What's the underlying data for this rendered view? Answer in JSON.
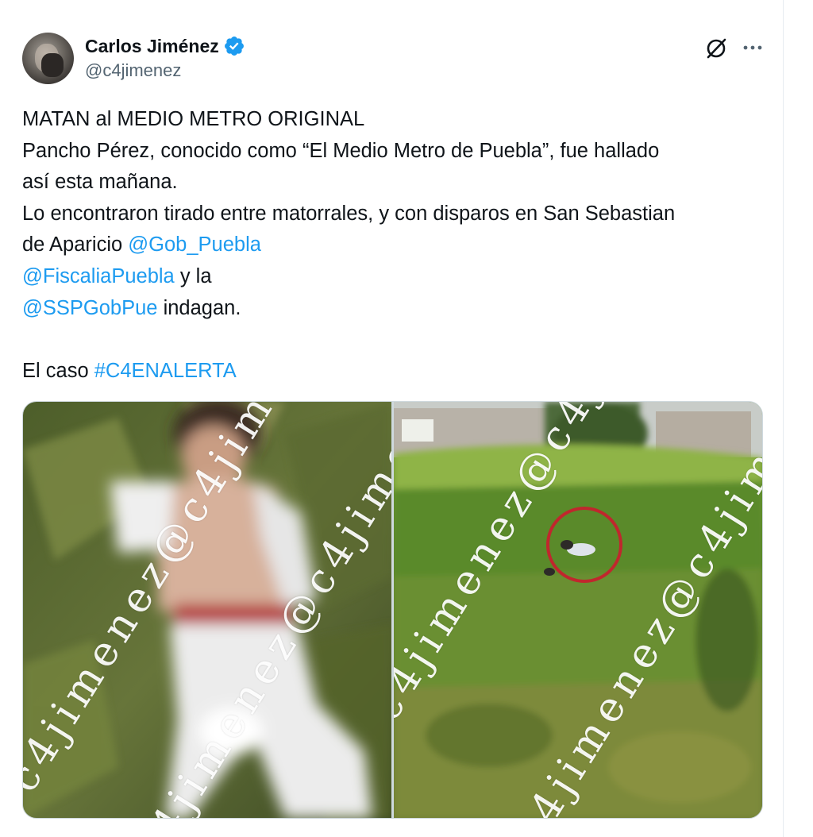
{
  "tweet": {
    "author": {
      "name": "Carlos Jiménez",
      "handle": "@c4jimenez",
      "verified": true,
      "verified_color": "#1d9bf0"
    },
    "icons": {
      "grok": "grok-icon",
      "more": "more-options-icon",
      "verified": "verified-badge-icon"
    },
    "text": {
      "line1": "MATAN al MEDIO METRO ORIGINAL",
      "line2": "Pancho Pérez, conocido como “El Medio Metro de Puebla”, fue hallado",
      "line3": "así esta mañana.",
      "line4": "Lo encontraron tirado entre matorrales, y con disparos en San Sebastian",
      "line5_text": "de Aparicio ",
      "mention1": "@Gob_Puebla",
      "mention2": "@FiscaliaPuebla",
      "line6_text": " y la",
      "mention3": "@SSPGobPue",
      "line7_text": " indagan.",
      "line9_text": "El caso ",
      "hashtag": "#C4ENALERTA"
    },
    "media": {
      "watermark": "c4jimenez@c4jimenez@c4jimenez@",
      "left_alt": "Photo of a body lying in the grass",
      "right_alt": "Photo of a grassy field with a red circle marking"
    },
    "colors": {
      "link": "#1d9bf0",
      "text": "#0f1419",
      "secondary": "#536471"
    }
  }
}
